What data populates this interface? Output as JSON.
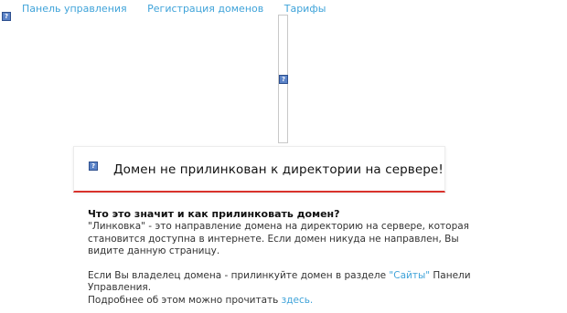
{
  "nav": {
    "items": [
      {
        "label": "Панель управления"
      },
      {
        "label": "Регистрация доменов"
      },
      {
        "label": "Тарифы"
      }
    ]
  },
  "icons": {
    "broken_image_glyph": "?"
  },
  "card": {
    "title": "Домен не прилинкован к директории на сервере!",
    "accent_color": "#d9322c"
  },
  "info": {
    "heading": "Что это значит и как прилинковать домен?",
    "paragraph1": "\"Линковка\" - это направление домена на директорию на сервере, которая становится доступна в интернете. Если домен никуда не направлен, Вы видите данную страницу.",
    "paragraph2_before": "Если Вы владелец домена - прилинкуйте домен в разделе ",
    "paragraph2_link": "\"Сайты\"",
    "paragraph2_after": " Панели Управления.",
    "paragraph3_before": "Подробнее об этом можно прочитать ",
    "paragraph3_link": "здесь."
  },
  "colors": {
    "link": "#3fa3d9",
    "icon": "#5b83c8"
  }
}
